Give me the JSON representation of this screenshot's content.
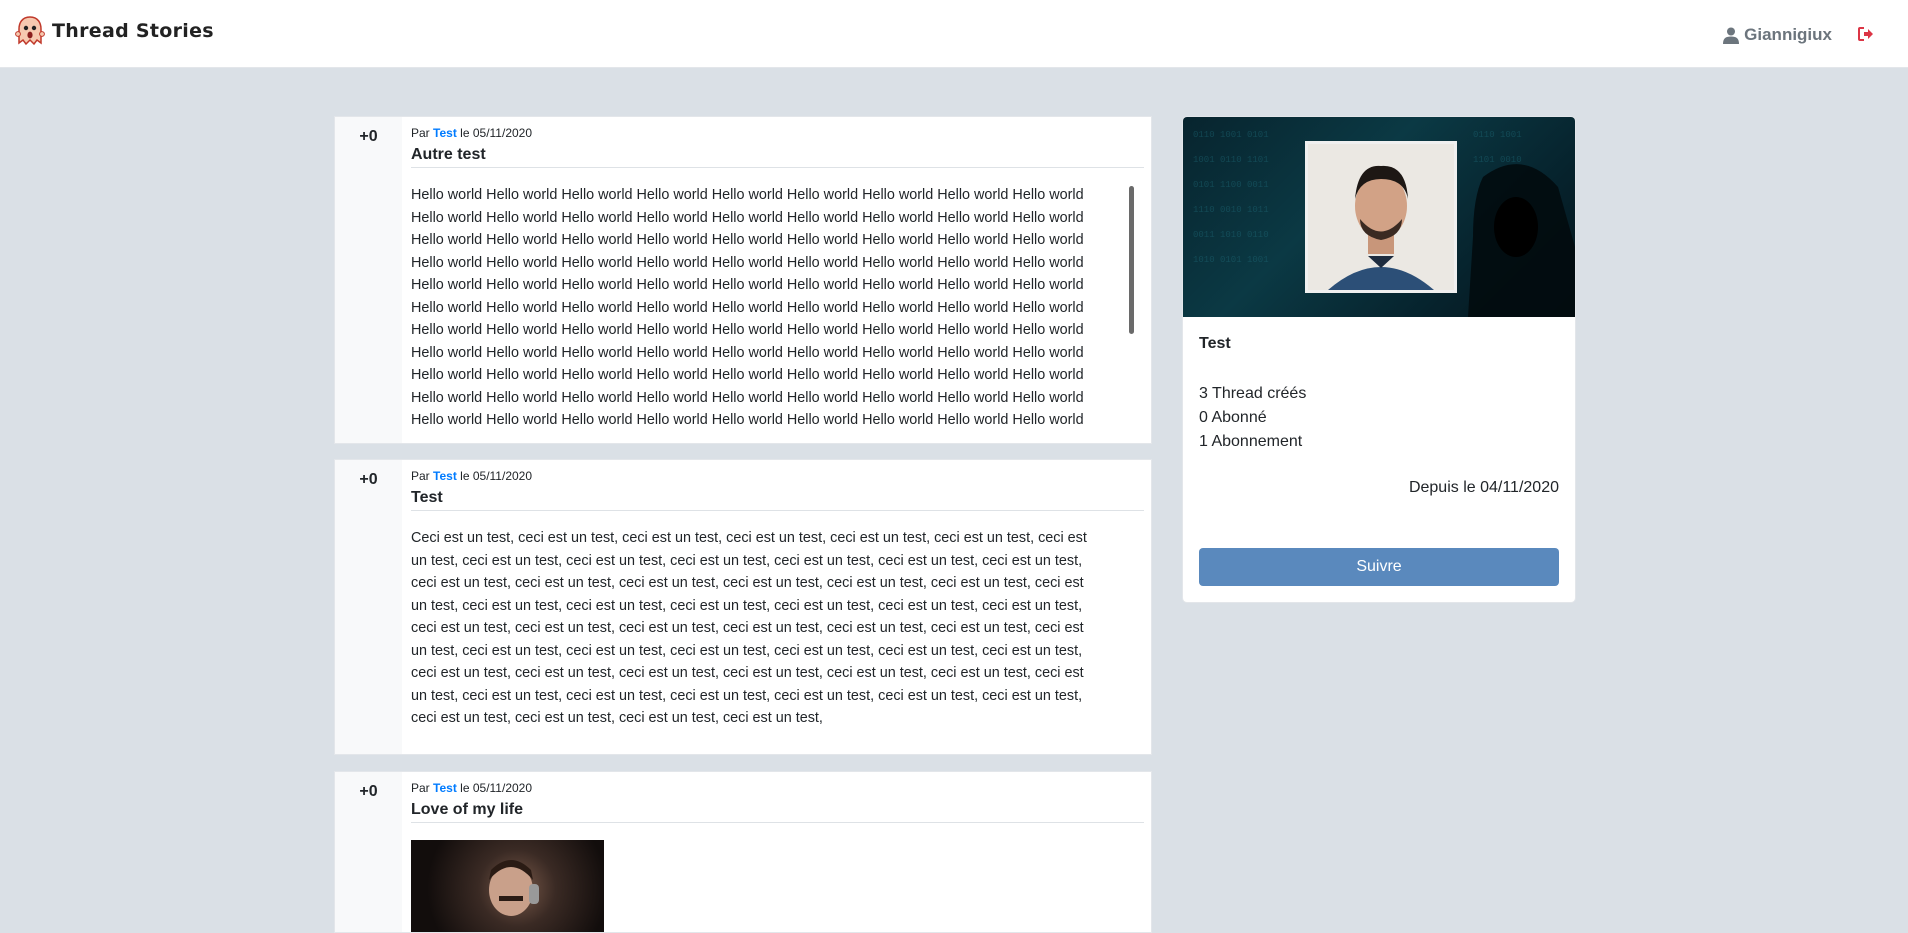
{
  "navbar": {
    "brand": "Thread Stories",
    "user": "Giannigiux"
  },
  "posts": [
    {
      "score": "+0",
      "meta_prefix": "Par",
      "author": "Test",
      "meta_date": "le 05/11/2020",
      "title": "Autre test",
      "lines": [
        "Hello world Hello world Hello world Hello world Hello world Hello world Hello world Hello world Hello world",
        "Hello world Hello world Hello world Hello world Hello world Hello world Hello world Hello world Hello world",
        "Hello world Hello world Hello world Hello world Hello world Hello world Hello world Hello world Hello world",
        "Hello world Hello world Hello world Hello world Hello world Hello world Hello world Hello world Hello world",
        "Hello world Hello world Hello world Hello world Hello world Hello world Hello world Hello world Hello world",
        "Hello world Hello world Hello world Hello world Hello world Hello world Hello world Hello world Hello world",
        "Hello world Hello world Hello world Hello world Hello world Hello world Hello world Hello world Hello world",
        "Hello world Hello world Hello world Hello world Hello world Hello world Hello world Hello world Hello world",
        "Hello world Hello world Hello world Hello world Hello world Hello world Hello world Hello world Hello world",
        "Hello world Hello world Hello world Hello world Hello world Hello world Hello world Hello world Hello world",
        "Hello world Hello world Hello world Hello world Hello world Hello world Hello world Hello world Hello world"
      ]
    },
    {
      "score": "+0",
      "meta_prefix": "Par",
      "author": "Test",
      "meta_date": "le 05/11/2020",
      "title": "Test",
      "lines": [
        "Ceci est un test, ceci est un test, ceci est un test, ceci est un test, ceci est un test, ceci est un test, ceci est",
        "un test, ceci est un test, ceci est un test, ceci est un test, ceci est un test, ceci est un test, ceci est un test,",
        "ceci est un test, ceci est un test, ceci est un test, ceci est un test, ceci est un test, ceci est un test, ceci est",
        "un test, ceci est un test, ceci est un test, ceci est un test, ceci est un test, ceci est un test, ceci est un test,",
        "ceci est un test, ceci est un test, ceci est un test, ceci est un test, ceci est un test, ceci est un test, ceci est",
        "un test, ceci est un test, ceci est un test, ceci est un test, ceci est un test, ceci est un test, ceci est un test,",
        "ceci est un test, ceci est un test, ceci est un test, ceci est un test, ceci est un test, ceci est un test, ceci est",
        "un test, ceci est un test, ceci est un test, ceci est un test, ceci est un test, ceci est un test, ceci est un test,",
        "ceci est un test, ceci est un test, ceci est un test, ceci est un test,"
      ]
    },
    {
      "score": "+0",
      "meta_prefix": "Par",
      "author": "Test",
      "meta_date": "le 05/11/2020",
      "title": "Love of my life"
    }
  ],
  "profile": {
    "name": "Test",
    "threads": "3 Thread créés",
    "followers": "0 Abonné",
    "following": "1 Abonnement",
    "since": "Depuis le 04/11/2020",
    "follow_label": "Suivre"
  }
}
